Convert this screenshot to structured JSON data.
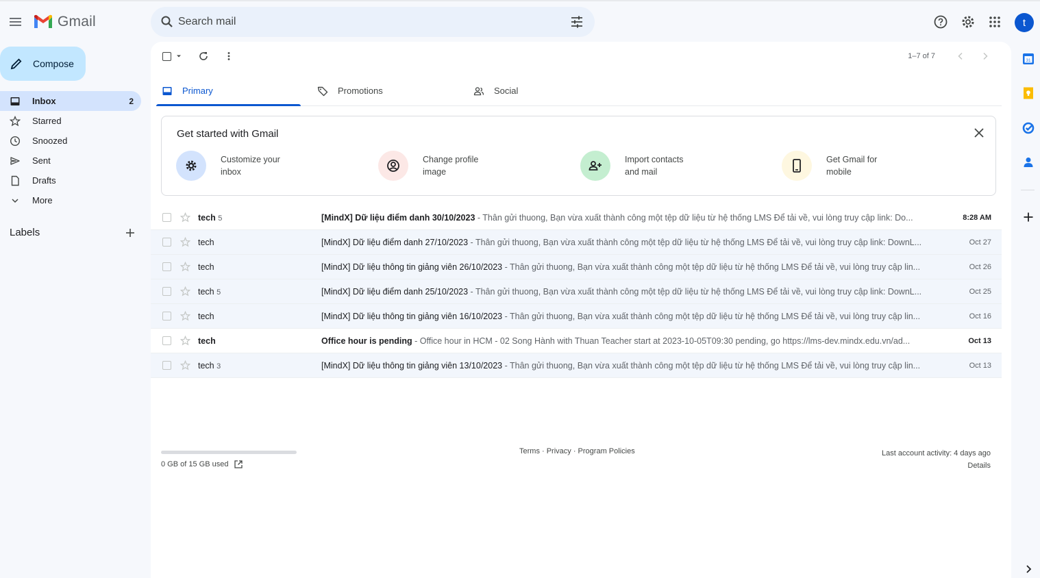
{
  "app": {
    "title": "Gmail",
    "search_placeholder": "Search mail",
    "avatar_letter": "t",
    "accent": "#0b57d0"
  },
  "sidebar": {
    "compose_label": "Compose",
    "items": [
      {
        "label": "Inbox",
        "icon": "inbox-icon",
        "count": "2",
        "active": true
      },
      {
        "label": "Starred",
        "icon": "star-icon"
      },
      {
        "label": "Snoozed",
        "icon": "clock-icon"
      },
      {
        "label": "Sent",
        "icon": "send-icon"
      },
      {
        "label": "Drafts",
        "icon": "draft-icon"
      },
      {
        "label": "More",
        "icon": "chevron-down-icon"
      }
    ],
    "labels_header": "Labels"
  },
  "toolbar": {
    "pager": "1–7 of 7"
  },
  "tabs": [
    {
      "label": "Primary",
      "icon": "inbox-icon",
      "active": true
    },
    {
      "label": "Promotions",
      "icon": "tag-icon"
    },
    {
      "label": "Social",
      "icon": "people-icon"
    }
  ],
  "promo": {
    "title": "Get started with Gmail",
    "items": [
      {
        "line1": "Customize your",
        "line2": "inbox",
        "icon": "gear-icon",
        "color": "#d3e3fd"
      },
      {
        "line1": "Change profile",
        "line2": "image",
        "icon": "account-icon",
        "color": "#fce8e6"
      },
      {
        "line1": "Import contacts",
        "line2": "and mail",
        "icon": "person-add-icon",
        "color": "#c4eed0"
      },
      {
        "line1": "Get Gmail for",
        "line2": "mobile",
        "icon": "phone-icon",
        "color": "#fef7e0"
      }
    ]
  },
  "emails": [
    {
      "sender": "tech",
      "count": "5",
      "subject": "[MindX] Dữ liệu điểm danh 30/10/2023",
      "snippet": " - Thân gửi thuong, Bạn vừa xuất thành công một tệp dữ liệu từ hệ thống LMS Để tải về, vui lòng truy cập link: Do...",
      "date": "8:28 AM",
      "unread": true
    },
    {
      "sender": "tech",
      "count": "",
      "subject": "[MindX] Dữ liệu điểm danh 27/10/2023",
      "snippet": " - Thân gửi thuong, Bạn vừa xuất thành công một tệp dữ liệu từ hệ thống LMS Để tải về, vui lòng truy cập link: DownL...",
      "date": "Oct 27",
      "unread": false
    },
    {
      "sender": "tech",
      "count": "",
      "subject": "[MindX] Dữ liệu thông tin giảng viên 26/10/2023",
      "snippet": " - Thân gửi thuong, Bạn vừa xuất thành công một tệp dữ liệu từ hệ thống LMS Để tải về, vui lòng truy cập lin...",
      "date": "Oct 26",
      "unread": false
    },
    {
      "sender": "tech",
      "count": "5",
      "subject": "[MindX] Dữ liệu điểm danh 25/10/2023",
      "snippet": " - Thân gửi thuong, Bạn vừa xuất thành công một tệp dữ liệu từ hệ thống LMS Để tải về, vui lòng truy cập link: DownL...",
      "date": "Oct 25",
      "unread": false
    },
    {
      "sender": "tech",
      "count": "",
      "subject": "[MindX] Dữ liệu thông tin giảng viên 16/10/2023",
      "snippet": " - Thân gửi thuong, Bạn vừa xuất thành công một tệp dữ liệu từ hệ thống LMS Để tải về, vui lòng truy cập lin...",
      "date": "Oct 16",
      "unread": false
    },
    {
      "sender": "tech",
      "count": "",
      "subject": "Office hour is pending",
      "snippet": " - Office hour in HCM - 02 Song Hành with Thuan Teacher start at 2023-10-05T09:30 pending, go https://lms-dev.mindx.edu.vn/ad...",
      "date": "Oct 13",
      "unread": true
    },
    {
      "sender": "tech",
      "count": "3",
      "subject": "[MindX] Dữ liệu thông tin giảng viên 13/10/2023",
      "snippet": " - Thân gửi thuong, Bạn vừa xuất thành công một tệp dữ liệu từ hệ thống LMS Để tải về, vui lòng truy cập lin...",
      "date": "Oct 13",
      "unread": false
    }
  ],
  "footer": {
    "storage": "0 GB of 15 GB used",
    "links": "Terms · Privacy · Program Policies",
    "activity": "Last account activity: 4 days ago",
    "details": "Details"
  }
}
